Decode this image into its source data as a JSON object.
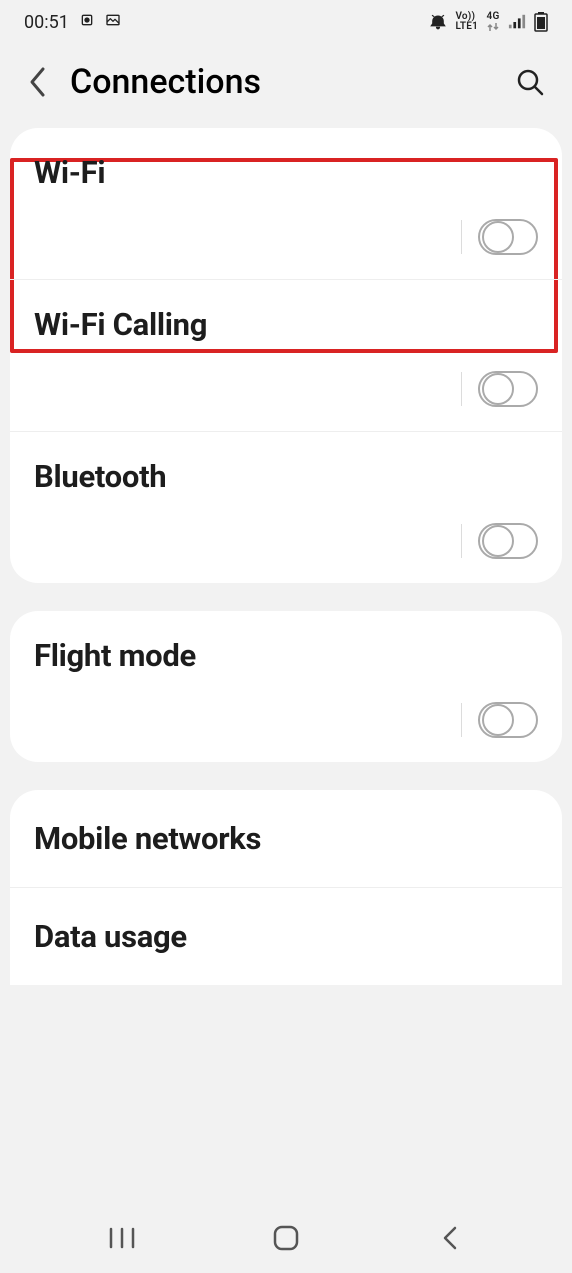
{
  "status": {
    "time": "00:51",
    "network_top": "Vo))",
    "network_bottom": "LTE1",
    "data": "4G"
  },
  "header": {
    "title": "Connections"
  },
  "groups": [
    {
      "rows": [
        {
          "title": "Wi-Fi",
          "toggle": true,
          "on": false,
          "highlight": true
        },
        {
          "title": "Wi-Fi Calling",
          "toggle": true,
          "on": false
        },
        {
          "title": "Bluetooth",
          "toggle": true,
          "on": false
        }
      ]
    },
    {
      "rows": [
        {
          "title": "Flight mode",
          "toggle": true,
          "on": false
        }
      ]
    },
    {
      "rows": [
        {
          "title": "Mobile networks",
          "toggle": false
        },
        {
          "title": "Data usage",
          "toggle": false
        }
      ]
    }
  ]
}
